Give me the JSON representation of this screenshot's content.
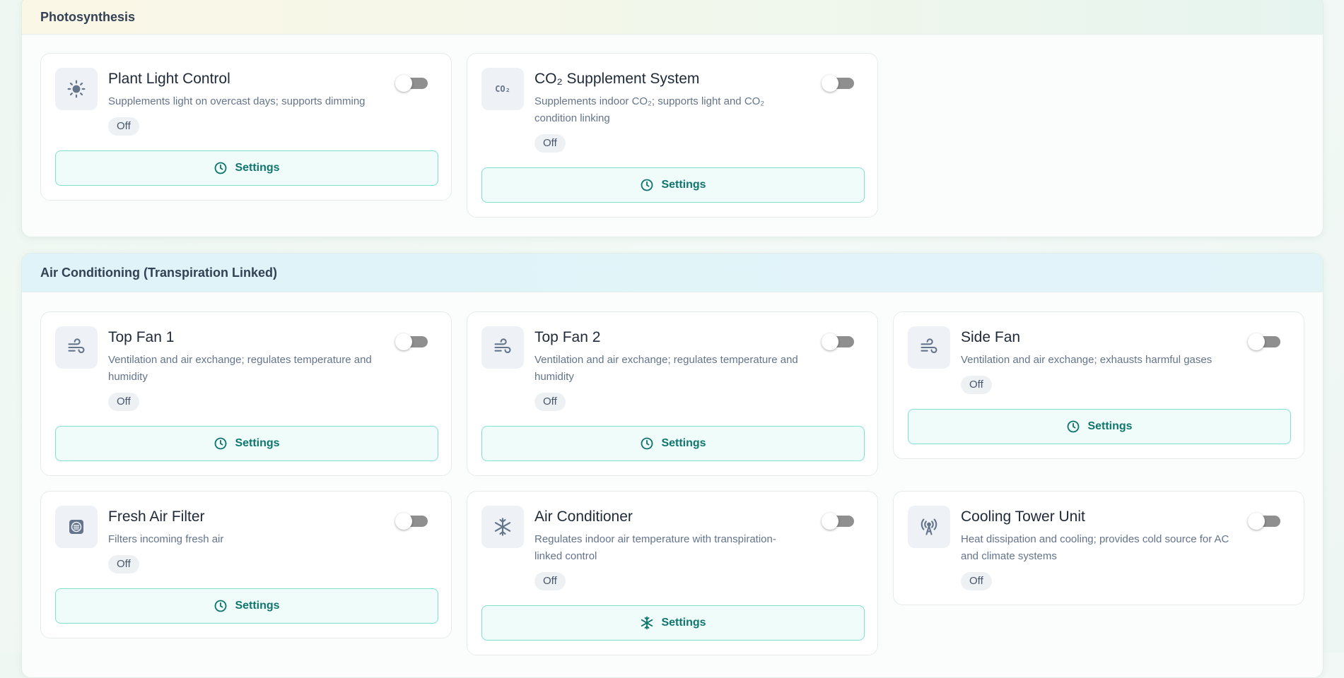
{
  "sections": {
    "photosynthesis": {
      "title": "Photosynthesis",
      "cards": {
        "plant_light": {
          "title": "Plant Light Control",
          "description": "Supplements light on overcast days; supports dimming",
          "status": "Off",
          "settings_label": "Settings",
          "icon": "sun-icon"
        },
        "co2": {
          "title": "CO₂ Supplement System",
          "description": "Supplements indoor CO₂; supports light and CO₂ condition linking",
          "status": "Off",
          "settings_label": "Settings",
          "icon": "co2-icon",
          "icon_text": "CO₂"
        }
      }
    },
    "air": {
      "title": "Air Conditioning (Transpiration Linked)",
      "cards": {
        "top_fan_1": {
          "title": "Top Fan 1",
          "description": "Ventilation and air exchange; regulates temperature and humidity",
          "status": "Off",
          "settings_label": "Settings",
          "icon": "wind-icon"
        },
        "top_fan_2": {
          "title": "Top Fan 2",
          "description": "Ventilation and air exchange; regulates temperature and humidity",
          "status": "Off",
          "settings_label": "Settings",
          "icon": "wind-icon"
        },
        "side_fan": {
          "title": "Side Fan",
          "description": "Ventilation and air exchange; exhausts harmful gases",
          "status": "Off",
          "settings_label": "Settings",
          "icon": "wind-icon"
        },
        "fresh_air": {
          "title": "Fresh Air Filter",
          "description": "Filters incoming fresh air",
          "status": "Off",
          "settings_label": "Settings",
          "icon": "filter-icon"
        },
        "air_conditioner": {
          "title": "Air Conditioner",
          "description": "Regulates indoor air temperature with transpiration-linked control",
          "status": "Off",
          "settings_label": "Settings",
          "icon": "snowflake-icon"
        },
        "cooling_tower": {
          "title": "Cooling Tower Unit",
          "description": "Heat dissipation and cooling; provides cold source for AC and climate systems",
          "status": "Off",
          "icon": "antenna-tower-icon"
        }
      }
    }
  },
  "colors": {
    "accent": "#0f766e",
    "button_border": "#7fe0d2",
    "toggle_off": "#8f8f8f"
  }
}
